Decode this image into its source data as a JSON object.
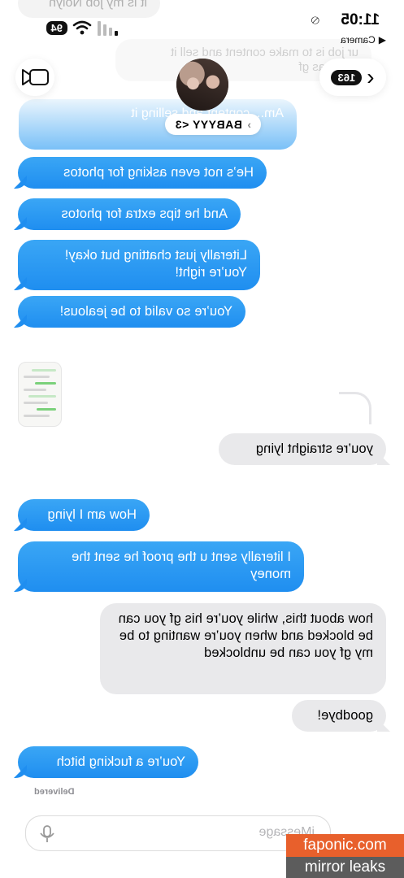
{
  "status_bar": {
    "time": "11:05",
    "back_label": "Camera",
    "battery": "94"
  },
  "header": {
    "back_count": "163",
    "contact_name": "BABYYY <3",
    "contact_chevron": "›"
  },
  "background_messages": {
    "top_received": "it is my job Nolyn",
    "received_2": "ur job is to make content and sell it",
    "received_3": "a niggas gf",
    "sent_partial": "Am... content and selling it"
  },
  "messages": [
    {
      "id": "m1",
      "side": "sent",
      "text": "He’s not even asking for photos"
    },
    {
      "id": "m2",
      "side": "sent",
      "text": "And he tips extra for photos"
    },
    {
      "id": "m3",
      "side": "sent",
      "text": "Literally just chatting but okay! You’re right!"
    },
    {
      "id": "m4",
      "side": "sent",
      "text": "You’re so valid to be jealous!"
    },
    {
      "id": "m5",
      "side": "recv",
      "text": "you’re straight lying"
    },
    {
      "id": "m6",
      "side": "sent",
      "text": "How am I lying"
    },
    {
      "id": "m7",
      "side": "sent",
      "text": "I literally sent u the proof he sent the money"
    },
    {
      "id": "m8",
      "side": "recv",
      "text": "how about this, while you’re his gf you can be blocked and when you’re wanting to be my gf you can be unblocked"
    },
    {
      "id": "m9",
      "side": "recv",
      "text": "goodbye!"
    },
    {
      "id": "m10",
      "side": "sent",
      "text": "You’re a fucking bitch"
    }
  ],
  "delivered_label": "Delivered",
  "input": {
    "placeholder": "iMessage"
  },
  "icons": [
    "video-call-icon",
    "back-chevron-icon",
    "mic-icon",
    "plus-icon",
    "wifi-icon",
    "signal-icon",
    "silent-bell-icon"
  ],
  "watermark": {
    "line1": "faponic.com",
    "line2": "mirror leaks"
  },
  "colors": {
    "sent_bubble": "#1f8ef0",
    "received_bubble": "#e9e9eb",
    "watermark_orange": "#e8602c",
    "watermark_gray": "#5c5c5c"
  }
}
